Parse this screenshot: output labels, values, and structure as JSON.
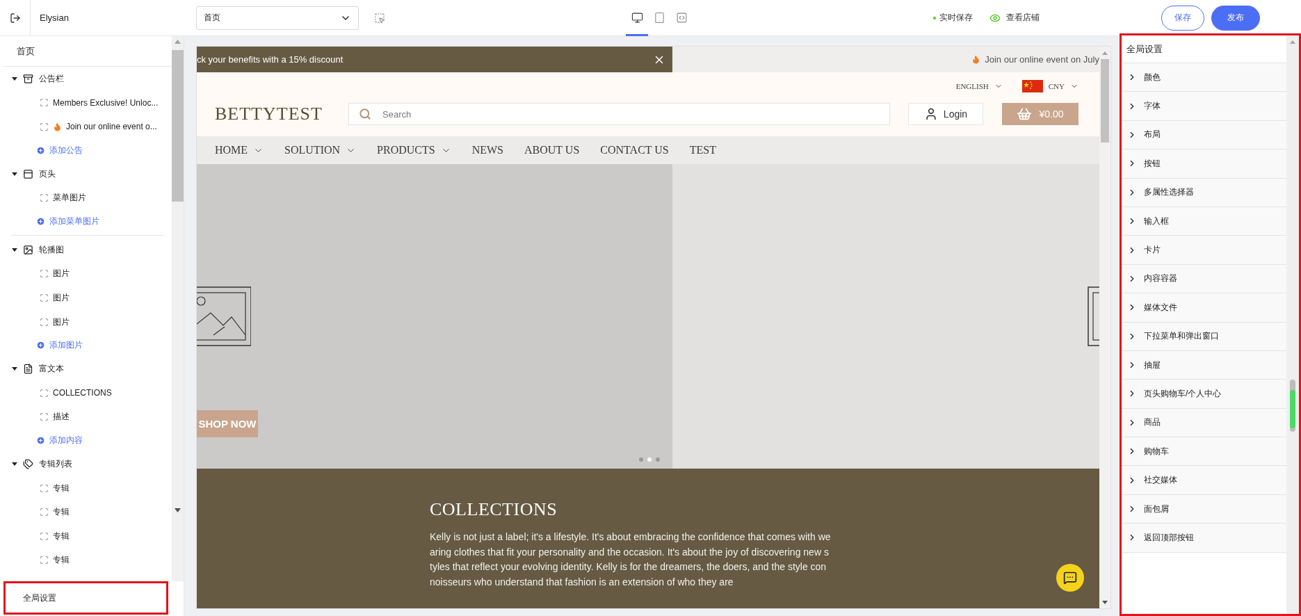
{
  "topbar": {
    "app_name": "Elysian",
    "page_select": "首页",
    "device_tabs": [
      {
        "kind": "desktop",
        "selected": true
      },
      {
        "kind": "tablet",
        "selected": false
      },
      {
        "kind": "code",
        "selected": false
      }
    ],
    "autosave": "实时保存",
    "view_store": "查看店铺",
    "buttons": [
      {
        "label": "保存",
        "kind": "secondary"
      },
      {
        "label": "发布",
        "kind": "primary"
      }
    ]
  },
  "outline": {
    "title": "首页",
    "sections": [
      {
        "label": "公告栏",
        "kind": "announcement",
        "expanded": true,
        "children": [
          {
            "label": "Members Exclusive! Unloc...",
            "kind": "plain"
          },
          {
            "label": "Join our online event o...",
            "kind": "flame"
          }
        ],
        "add": "添加公告"
      },
      {
        "label": "页头",
        "kind": "header",
        "expanded": true,
        "children": [
          {
            "label": "菜单图片",
            "kind": "plain"
          }
        ],
        "add": "添加菜单图片"
      },
      {
        "label": "轮播图",
        "kind": "carousel",
        "expanded": true,
        "children": [
          {
            "label": "图片",
            "kind": "plain"
          },
          {
            "label": "图片",
            "kind": "plain"
          },
          {
            "label": "图片",
            "kind": "plain"
          }
        ],
        "add": "添加图片"
      },
      {
        "label": "富文本",
        "kind": "richtext",
        "expanded": true,
        "children": [
          {
            "label": "COLLECTIONS",
            "kind": "plain"
          },
          {
            "label": "描述",
            "kind": "plain"
          }
        ],
        "add": "添加内容"
      },
      {
        "label": "专辑列表",
        "kind": "collections",
        "expanded": true,
        "children": [
          {
            "label": "专辑",
            "kind": "plain"
          },
          {
            "label": "专辑",
            "kind": "plain"
          },
          {
            "label": "专辑",
            "kind": "plain"
          },
          {
            "label": "专辑",
            "kind": "plain"
          }
        ]
      }
    ],
    "footer": {
      "label": "全局设置",
      "highlighted": true
    }
  },
  "preview": {
    "announcements": [
      {
        "text": "ck your benefits with a 15% discount",
        "kind": "plain",
        "closable": true
      },
      {
        "text": "Join our online event on July",
        "kind": "flame",
        "closable": false
      }
    ],
    "language": "ENGLISH",
    "currency": "CNY",
    "logo": "BETTYTEST",
    "search_placeholder": "Search",
    "login": "Login",
    "cart": "¥0.00",
    "nav": [
      {
        "label": "HOME",
        "has_menu": true
      },
      {
        "label": "SOLUTION",
        "has_menu": true
      },
      {
        "label": "PRODUCTS",
        "has_menu": true
      },
      {
        "label": "NEWS",
        "has_menu": false
      },
      {
        "label": "ABOUT US",
        "has_menu": false
      },
      {
        "label": "CONTACT US",
        "has_menu": false
      },
      {
        "label": "TEST",
        "has_menu": false
      }
    ],
    "hero": {
      "button": "SHOP NOW",
      "dots": [
        {
          "selected": false
        },
        {
          "selected": true
        },
        {
          "selected": false
        }
      ]
    },
    "collections": {
      "title": "COLLECTIONS",
      "lines": [
        "Kelly is not just a label; it's a lifestyle. It's about embracing the confidence that comes with we",
        "aring clothes that fit your personality and the occasion. It's about the joy of discovering new s",
        "tyles that reflect your evolving identity. Kelly is for the dreamers, the doers, and the style con",
        "noisseurs who understand that fashion is an extension of who they are"
      ]
    }
  },
  "settings": {
    "title": "全局设置",
    "highlighted": true,
    "items": [
      {
        "label": "颜色",
        "expanded": false
      },
      {
        "label": "字体",
        "expanded": false
      },
      {
        "label": "布局",
        "expanded": false
      },
      {
        "label": "按钮",
        "expanded": false
      },
      {
        "label": "多属性选择器",
        "expanded": false
      },
      {
        "label": "输入框",
        "expanded": false
      },
      {
        "label": "卡片",
        "expanded": false
      },
      {
        "label": "内容容器",
        "expanded": false
      },
      {
        "label": "媒体文件",
        "expanded": false
      },
      {
        "label": "下拉菜单和弹出窗口",
        "expanded": false
      },
      {
        "label": "抽屉",
        "expanded": false
      },
      {
        "label": "页头购物车/个人中心",
        "expanded": false
      },
      {
        "label": "商品",
        "expanded": false
      },
      {
        "label": "购物车",
        "expanded": false
      },
      {
        "label": "社交媒体",
        "expanded": false
      },
      {
        "label": "面包屑",
        "expanded": false
      },
      {
        "label": "返回顶部按钮",
        "expanded": false
      }
    ]
  }
}
